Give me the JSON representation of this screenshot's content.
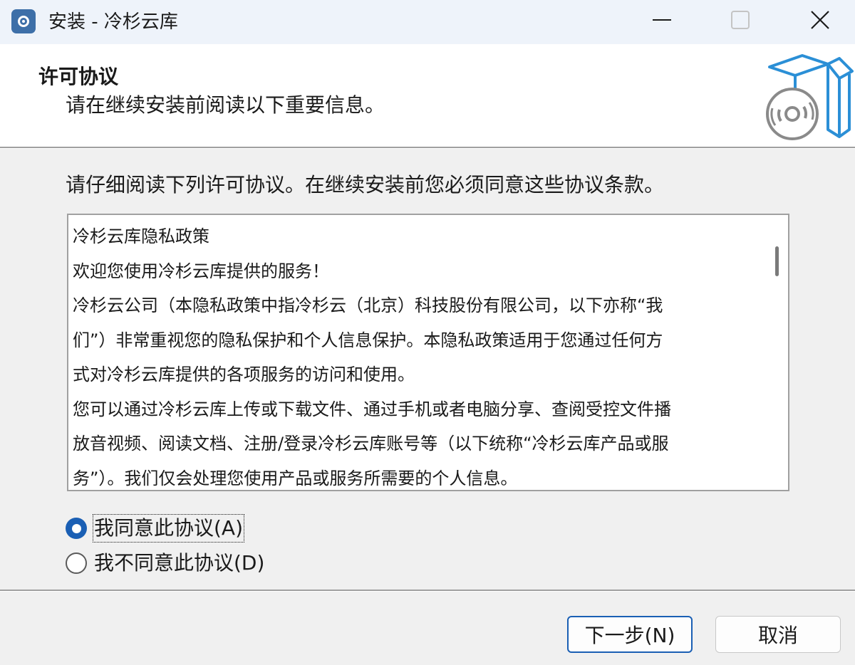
{
  "window": {
    "title": "安装 - 冷杉云库",
    "icon": "app-logo-icon",
    "controls": [
      "minimize-icon",
      "maximize-icon",
      "close-icon"
    ]
  },
  "header": {
    "title": "许可协议",
    "subtitle": "请在继续安装前阅读以下重要信息。",
    "icon": "software-box-icon"
  },
  "main": {
    "instruction": "请仔细阅读下列许可协议。在继续安装前您必须同意这些协议条款。",
    "license_lines": [
      "冷杉云库隐私政策",
      "欢迎您使用冷杉云库提供的服务！",
      "冷杉云公司（本隐私政策中指冷杉云（北京）科技股份有限公司，以下亦称“我",
      "们”）非常重视您的隐私保护和个人信息保护。本隐私政策适用于您通过任何方",
      "式对冷杉云库提供的各项服务的访问和使用。",
      "您可以通过冷杉云库上传或下载文件、通过手机或者电脑分享、查阅受控文件播",
      "放音视频、阅读文档、注册/登录冷杉云库账号等（以下统称“冷杉云库产品或服",
      "务”）。我们仅会处理您使用产品或服务所需要的个人信息。"
    ],
    "options": {
      "accept": "我同意此协议(A)",
      "decline": "我不同意此协议(D)",
      "selected": "accept"
    }
  },
  "footer": {
    "next": "下一步(N)",
    "cancel": "取消"
  },
  "colors": {
    "accent": "#1a5fb4",
    "titlebar": "#eef3fa",
    "dialog": "#f0f0f0"
  }
}
